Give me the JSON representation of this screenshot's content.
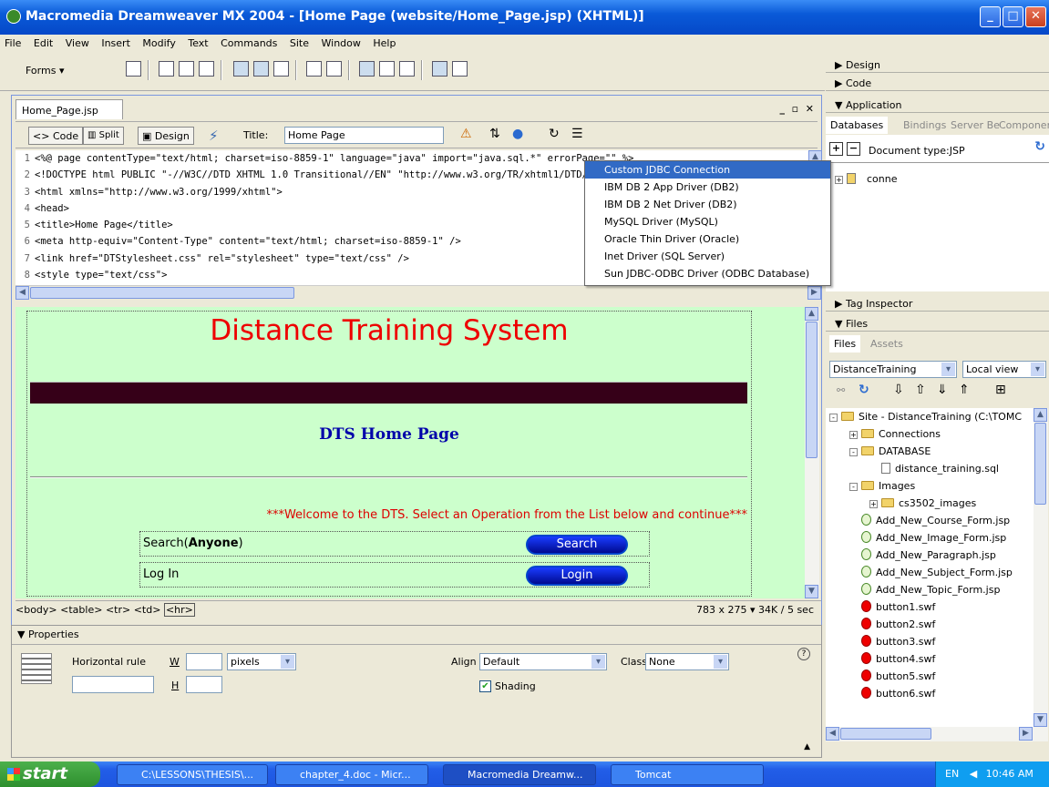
{
  "window": {
    "title": "Macromedia Dreamweaver MX 2004 - [Home Page (website/Home_Page.jsp) (XHTML)]"
  },
  "menu": [
    "File",
    "Edit",
    "View",
    "Insert",
    "Modify",
    "Text",
    "Commands",
    "Site",
    "Window",
    "Help"
  ],
  "insertbar": {
    "category": "Forms"
  },
  "document": {
    "tab": "Home_Page.jsp",
    "views": {
      "code": "Code",
      "split": "Split",
      "design": "Design"
    },
    "title_label": "Title:",
    "title_value": "Home Page",
    "code_lines": [
      "<%@ page contentType=\"text/html; charset=iso-8859-1\" language=\"java\" import=\"java.sql.*\" errorPage=\"\" %>",
      "<!DOCTYPE html PUBLIC \"-//W3C//DTD XHTML 1.0 Transitional//EN\" \"http://www.w3.org/TR/xhtml1/DTD/xhtml1-transitional.dtd\">",
      "<html xmlns=\"http://www.w3.org/1999/xhtml\">",
      "<head>",
      "<title>Home Page</title>",
      "<meta http-equiv=\"Content-Type\" content=\"text/html; charset=iso-8859-1\" />",
      "<link href=\"DTStylesheet.css\" rel=\"stylesheet\" type=\"text/css\" />",
      "<style type=\"text/css\">"
    ],
    "design": {
      "heading": "Distance Training System",
      "subheading": "DTS Home Page",
      "welcome": "***Welcome to the DTS. Select an Operation from the List below and continue***",
      "rows": [
        {
          "label_prefix": "Search(",
          "label_bold": "Anyone",
          "label_suffix": ")",
          "button": "Search"
        },
        {
          "label_prefix": "Log In",
          "label_bold": "",
          "label_suffix": "",
          "button": "Login"
        }
      ]
    },
    "tag_selector": [
      "<body>",
      "<table>",
      "<tr>",
      "<td>",
      "<hr>"
    ],
    "status": "783 x 275 ▾ 34K / 5 sec"
  },
  "properties": {
    "header": "Properties",
    "element": "Horizontal rule",
    "w_label": "W",
    "h_label": "H",
    "units": "pixels",
    "align_label": "Align",
    "align_value": "Default",
    "class_label": "Class",
    "class_value": "None",
    "shading_label": "Shading"
  },
  "panels": {
    "design": "Design",
    "code": "Code",
    "application": "Application",
    "app_tabs": [
      "Databases",
      "Bindings",
      "Server Be",
      "Componer"
    ],
    "doc_type": "Document type:JSP",
    "connection": "conne",
    "tag_inspector": "Tag Inspector",
    "files_header": "Files",
    "files_tabs": [
      "Files",
      "Assets"
    ],
    "site_select": "DistanceTraining",
    "view_select": "Local view",
    "tree": [
      {
        "name": "Site - DistanceTraining (C:\\TOMC",
        "type": "folder",
        "indent": 0,
        "pm": "-"
      },
      {
        "name": "Connections",
        "type": "folder",
        "indent": 1,
        "pm": "+"
      },
      {
        "name": "DATABASE",
        "type": "folder",
        "indent": 1,
        "pm": "-"
      },
      {
        "name": "distance_training.sql",
        "type": "sql",
        "indent": 2,
        "pm": ""
      },
      {
        "name": "Images",
        "type": "folder",
        "indent": 1,
        "pm": "-"
      },
      {
        "name": "cs3502_images",
        "type": "folder",
        "indent": 2,
        "pm": "+"
      },
      {
        "name": "Add_New_Course_Form.jsp",
        "type": "jsp",
        "indent": 1,
        "pm": ""
      },
      {
        "name": "Add_New_Image_Form.jsp",
        "type": "jsp",
        "indent": 1,
        "pm": ""
      },
      {
        "name": "Add_New_Paragraph.jsp",
        "type": "jsp",
        "indent": 1,
        "pm": ""
      },
      {
        "name": "Add_New_Subject_Form.jsp",
        "type": "jsp",
        "indent": 1,
        "pm": ""
      },
      {
        "name": "Add_New_Topic_Form.jsp",
        "type": "jsp",
        "indent": 1,
        "pm": ""
      },
      {
        "name": "button1.swf",
        "type": "swf",
        "indent": 1,
        "pm": ""
      },
      {
        "name": "button2.swf",
        "type": "swf",
        "indent": 1,
        "pm": ""
      },
      {
        "name": "button3.swf",
        "type": "swf",
        "indent": 1,
        "pm": ""
      },
      {
        "name": "button4.swf",
        "type": "swf",
        "indent": 1,
        "pm": ""
      },
      {
        "name": "button5.swf",
        "type": "swf",
        "indent": 1,
        "pm": ""
      },
      {
        "name": "button6.swf",
        "type": "swf",
        "indent": 1,
        "pm": ""
      }
    ]
  },
  "dropdown": [
    "Custom JDBC Connection",
    "IBM DB 2 App Driver (DB2)",
    "IBM DB 2 Net Driver (DB2)",
    "MySQL Driver (MySQL)",
    "Oracle Thin Driver (Oracle)",
    "Inet Driver (SQL Server)",
    "Sun JDBC-ODBC Driver (ODBC Database)"
  ],
  "taskbar": {
    "start": "start",
    "tasks": [
      "C:\\LESSONS\\THESIS\\...",
      "chapter_4.doc - Micr...",
      "Macromedia Dreamw...",
      "Tomcat"
    ],
    "lang": "EN",
    "time": "10:46 AM"
  },
  "colors": {
    "heading": "#ff0000",
    "subheading": "#0000aa",
    "design_bg": "#ccffcc",
    "titlebar": "#0a5ad8"
  }
}
